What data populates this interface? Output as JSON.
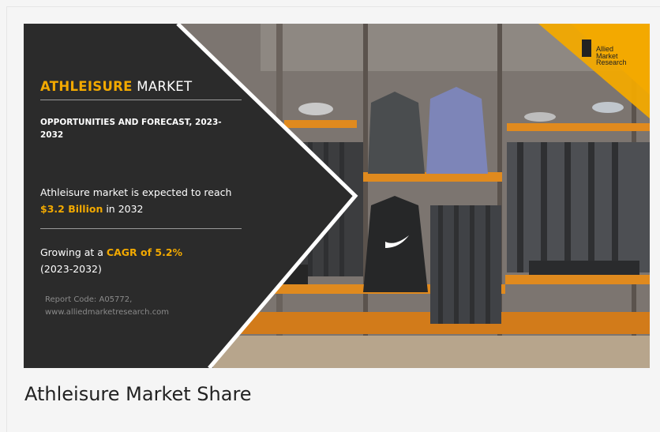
{
  "banner": {
    "title_accent": "ATHLEISURE",
    "title_rest": "MARKET",
    "subtitle": "OPPORTUNITIES AND FORECAST, 2023-2032",
    "forecast_prefix": "Athleisure market is expected to reach ",
    "forecast_value": "$3.2 Billion",
    "forecast_suffix": " in 2032",
    "growth_prefix": "Growing at a ",
    "growth_value": "CAGR of 5.2%",
    "growth_period": "(2023-2032)",
    "report_code": "Report Code: A05772,",
    "website": "www.alliedmarketresearch.com",
    "logo_line1": "Allied",
    "logo_line2": "Market",
    "logo_line3": "Research",
    "accent_color": "#f2a900",
    "panel_color": "#2b2b2b"
  },
  "caption": "Athleisure Market Share"
}
